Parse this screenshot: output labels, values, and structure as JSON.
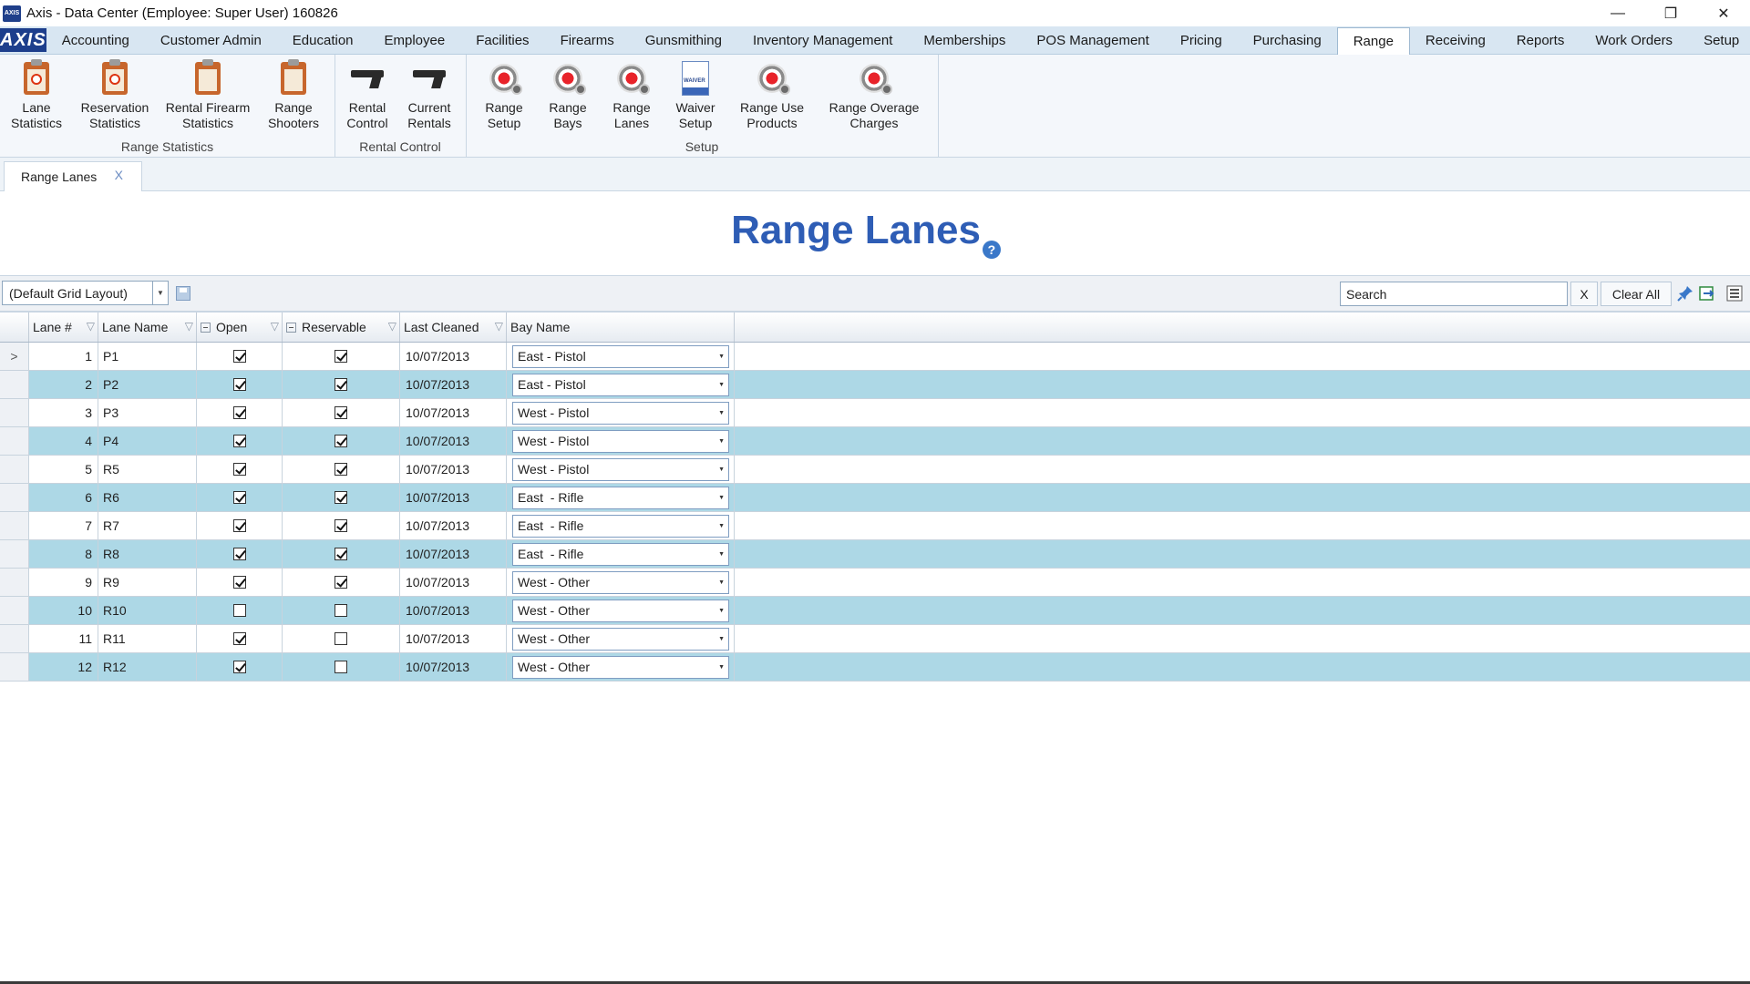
{
  "window": {
    "app_icon_text": "AXIS",
    "title": "Axis - Data Center  (Employee: Super User) 160826",
    "minimize": "—",
    "restore": "❐",
    "close": "✕"
  },
  "menu": {
    "logo": "AXIS",
    "items": [
      "Accounting",
      "Customer Admin",
      "Education",
      "Employee",
      "Facilities",
      "Firearms",
      "Gunsmithing",
      "Inventory Management",
      "Memberships",
      "POS Management",
      "Pricing",
      "Purchasing",
      "Range",
      "Receiving",
      "Reports",
      "Work Orders",
      "Setup"
    ],
    "active": "Range"
  },
  "ribbon": {
    "groups": [
      {
        "label": "Range Statistics",
        "buttons": [
          {
            "line1": "Lane",
            "line2": "Statistics",
            "icon": "clipboard-target-icon"
          },
          {
            "line1": "Reservation",
            "line2": "Statistics",
            "icon": "clipboard-target-icon"
          },
          {
            "line1": "Rental Firearm",
            "line2": "Statistics",
            "icon": "clipboard-gun-icon"
          },
          {
            "line1": "Range",
            "line2": "Shooters",
            "icon": "clipboard-person-icon"
          }
        ]
      },
      {
        "label": "Rental Control",
        "buttons": [
          {
            "line1": "Rental",
            "line2": "Control",
            "icon": "pistol-icon"
          },
          {
            "line1": "Current",
            "line2": "Rentals",
            "icon": "pistol-icon"
          }
        ]
      },
      {
        "label": "Setup",
        "buttons": [
          {
            "line1": "Range",
            "line2": "Setup",
            "icon": "target-gear-icon"
          },
          {
            "line1": "Range",
            "line2": "Bays",
            "icon": "target-gear-icon"
          },
          {
            "line1": "Range",
            "line2": "Lanes",
            "icon": "target-gear-icon"
          },
          {
            "line1": "Waiver",
            "line2": "Setup",
            "icon": "waiver-document-icon"
          },
          {
            "line1": "Range Use",
            "line2": "Products",
            "icon": "target-gear-icon"
          },
          {
            "line1": "Range Overage",
            "line2": "Charges",
            "icon": "target-gear-icon"
          }
        ]
      }
    ]
  },
  "doc_tab": {
    "label": "Range Lanes",
    "close": "X"
  },
  "page": {
    "title": "Range Lanes",
    "help": "?"
  },
  "toolbar": {
    "layout_value": "(Default Grid Layout)",
    "search_value": "Search",
    "search_clear": "X",
    "clear_all": "Clear All"
  },
  "grid": {
    "columns": [
      "Lane #",
      "Lane Name",
      "Open",
      "Reservable",
      "Last Cleaned",
      "Bay Name"
    ],
    "current_row_marker": ">",
    "rows": [
      {
        "lane": "1",
        "name": "P1",
        "open": true,
        "reservable": true,
        "cleaned": "10/07/2013",
        "bay": "East - Pistol"
      },
      {
        "lane": "2",
        "name": "P2",
        "open": true,
        "reservable": true,
        "cleaned": "10/07/2013",
        "bay": "East - Pistol"
      },
      {
        "lane": "3",
        "name": "P3",
        "open": true,
        "reservable": true,
        "cleaned": "10/07/2013",
        "bay": "West - Pistol"
      },
      {
        "lane": "4",
        "name": "P4",
        "open": true,
        "reservable": true,
        "cleaned": "10/07/2013",
        "bay": "West - Pistol"
      },
      {
        "lane": "5",
        "name": "R5",
        "open": true,
        "reservable": true,
        "cleaned": "10/07/2013",
        "bay": "West - Pistol"
      },
      {
        "lane": "6",
        "name": "R6",
        "open": true,
        "reservable": true,
        "cleaned": "10/07/2013",
        "bay": "East  - Rifle"
      },
      {
        "lane": "7",
        "name": "R7",
        "open": true,
        "reservable": true,
        "cleaned": "10/07/2013",
        "bay": "East  - Rifle"
      },
      {
        "lane": "8",
        "name": "R8",
        "open": true,
        "reservable": true,
        "cleaned": "10/07/2013",
        "bay": "East  - Rifle"
      },
      {
        "lane": "9",
        "name": "R9",
        "open": true,
        "reservable": true,
        "cleaned": "10/07/2013",
        "bay": "West - Other"
      },
      {
        "lane": "10",
        "name": "R10",
        "open": false,
        "reservable": false,
        "cleaned": "10/07/2013",
        "bay": "West - Other"
      },
      {
        "lane": "11",
        "name": "R11",
        "open": true,
        "reservable": false,
        "cleaned": "10/07/2013",
        "bay": "West - Other"
      },
      {
        "lane": "12",
        "name": "R12",
        "open": true,
        "reservable": false,
        "cleaned": "10/07/2013",
        "bay": "West - Other"
      }
    ]
  },
  "colors": {
    "accent": "#2e5db5",
    "alt_row": "#add8e6",
    "menu_bg": "#d8e6f2"
  }
}
